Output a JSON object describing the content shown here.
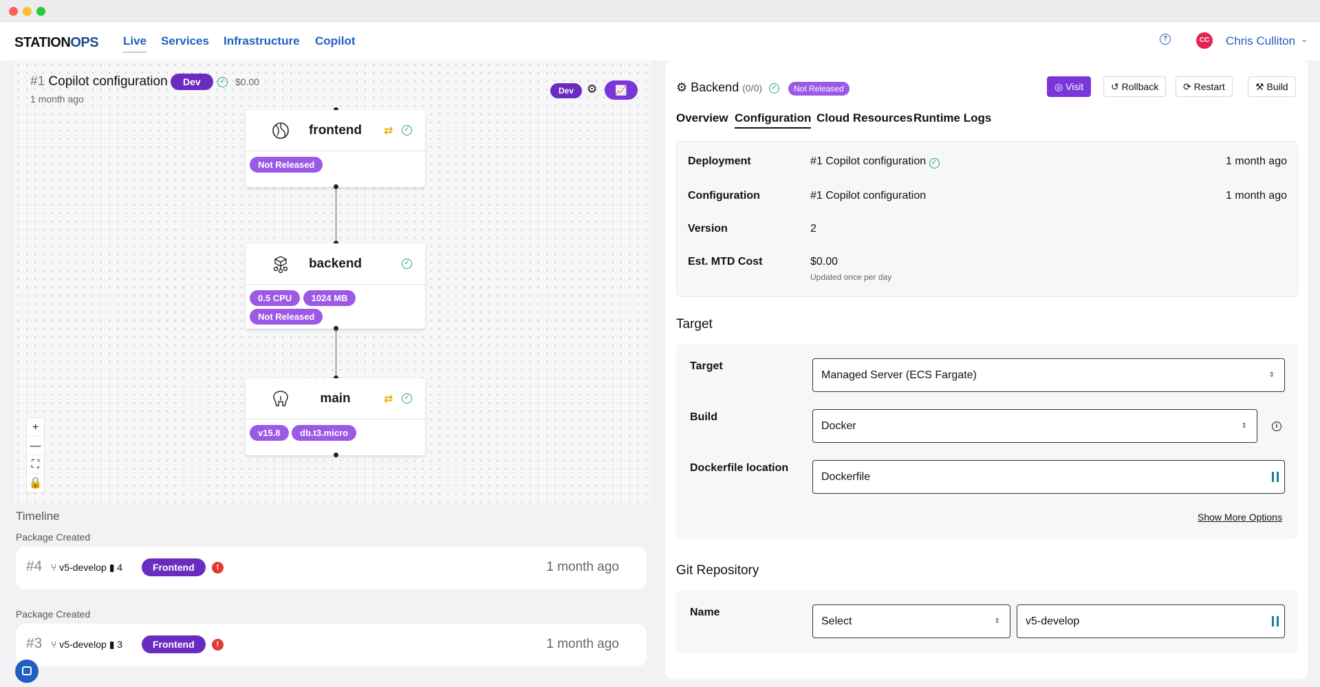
{
  "app": {
    "logo_main": "STATION",
    "logo_accent": "OPS"
  },
  "nav": {
    "links": [
      "Live",
      "Services",
      "Infrastructure",
      "Copilot"
    ],
    "help_glyph": "?",
    "user_initials": "CC",
    "user_name": "Chris Culliton"
  },
  "environment": {
    "hash": "#1",
    "title": "Copilot configuration",
    "env_pill": "Dev",
    "cost": "$0.00",
    "time": "1 month ago",
    "toolbar_env": "Dev"
  },
  "services": [
    {
      "name": "frontend",
      "icon": "globe-icon",
      "tags": [
        "Not Released"
      ],
      "synced": true
    },
    {
      "name": "backend",
      "icon": "backend-service-icon",
      "tags": [
        "0.5 CPU",
        "1024 MB",
        "Not Released"
      ],
      "synced": false
    },
    {
      "name": "main",
      "icon": "postgres-elephant-icon",
      "tags": [
        "v15.8",
        "db.t3.micro"
      ],
      "synced": true
    }
  ],
  "zoom_controls": [
    "+",
    "—",
    "⛶",
    "🔒"
  ],
  "timeline": {
    "title": "Timeline",
    "entries": [
      {
        "label": "Package Created",
        "num": "#4",
        "branch": "v5-develop",
        "files": "4",
        "pill": "Frontend",
        "time": "1 month ago"
      },
      {
        "label": "Package Created",
        "num": "#3",
        "branch": "v5-develop",
        "files": "3",
        "pill": "Frontend",
        "time": "1 month ago"
      }
    ]
  },
  "panel": {
    "title": "Backend",
    "count": "(0/0)",
    "status_badge": "Not Released",
    "buttons": {
      "visit": "Visit",
      "rollback": "Rollback",
      "restart": "Restart",
      "build": "Build"
    },
    "tabs": [
      "Overview",
      "Configuration",
      "Cloud Resources",
      "Runtime Logs"
    ],
    "info": {
      "deployment_label": "Deployment",
      "deployment_value": "#1 Copilot configuration",
      "deployment_time": "1 month ago",
      "configuration_label": "Configuration",
      "configuration_value": "#1 Copilot configuration",
      "configuration_time": "1 month ago",
      "version_label": "Version",
      "version_value": "2",
      "cost_label": "Est. MTD Cost",
      "cost_value": "$0.00",
      "cost_note": "Updated once per day"
    },
    "target_section": {
      "title": "Target",
      "target_label": "Target",
      "target_value": "Managed Server (ECS Fargate)",
      "build_label": "Build",
      "build_value": "Docker",
      "dockerfile_label": "Dockerfile location",
      "dockerfile_value": "Dockerfile",
      "more_options": "Show More Options"
    },
    "git_section": {
      "title": "Git Repository",
      "name_label": "Name",
      "repo_select": "Select",
      "branch_value": "v5-develop"
    }
  },
  "colors": {
    "accent_purple": "#7b35d8",
    "tag_purple": "#9b59e6",
    "link_blue": "#1f5fbf",
    "success_green": "#20a86b",
    "error_red": "#e53935"
  }
}
